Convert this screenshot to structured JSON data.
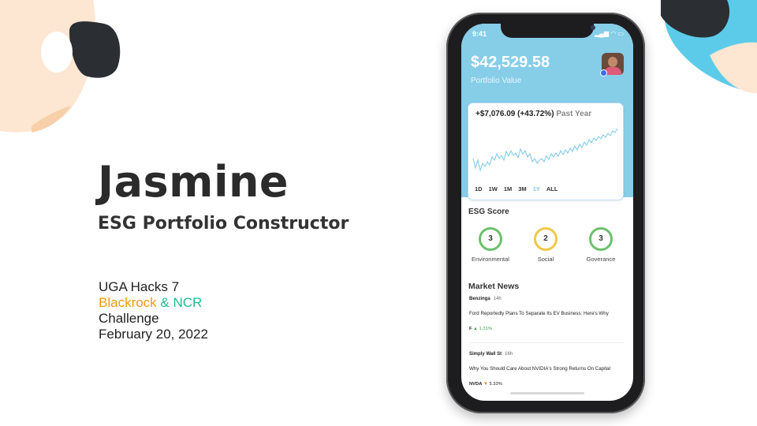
{
  "slide": {
    "title": "Jasmine",
    "subtitle": "ESG Portfolio Constructor",
    "event": "UGA Hacks 7",
    "sponsor_a": "Blackrock",
    "amp": "&",
    "sponsor_b": "NCR",
    "challenge": "Challenge",
    "date": "February 20, 2022"
  },
  "app": {
    "status_time": "9:41",
    "portfolio_value": "$42,529.58",
    "portfolio_label": "Portfolio Value",
    "gain": "+$7,076.09 (+43.72%)",
    "gain_period": "Past Year",
    "ranges": [
      "1D",
      "1W",
      "1M",
      "3M",
      "1Y",
      "ALL"
    ],
    "active_range": "1Y",
    "esg_title": "ESG Score",
    "esg": [
      {
        "score": "3",
        "label": "Environmental",
        "color": "#6cc06c"
      },
      {
        "score": "2",
        "label": "Social",
        "color": "#efc84a"
      },
      {
        "score": "3",
        "label": "Goverance",
        "color": "#6cc06c"
      }
    ],
    "news_title": "Market News",
    "news": [
      {
        "source": "Benzinga",
        "age": "14h",
        "headline": "Ford Reportedly Plans To Separate Its EV Business: Here's Why",
        "ticker": "F",
        "change": "1.31%",
        "direction": "up"
      },
      {
        "source": "Simply Wall St",
        "age": "16h",
        "headline": "Why You Should Care About NVIDIA's Strong Returns On Capital",
        "ticker": "NVDA",
        "change": "5.33%",
        "direction": "down"
      }
    ]
  },
  "colors": {
    "accent": "#86cde8",
    "orange": "#f29a0e",
    "green": "#1fbf8f",
    "deco_dark": "#2b2e33",
    "deco_peach": "#fde6d2",
    "deco_cyan": "#5ccbea"
  }
}
